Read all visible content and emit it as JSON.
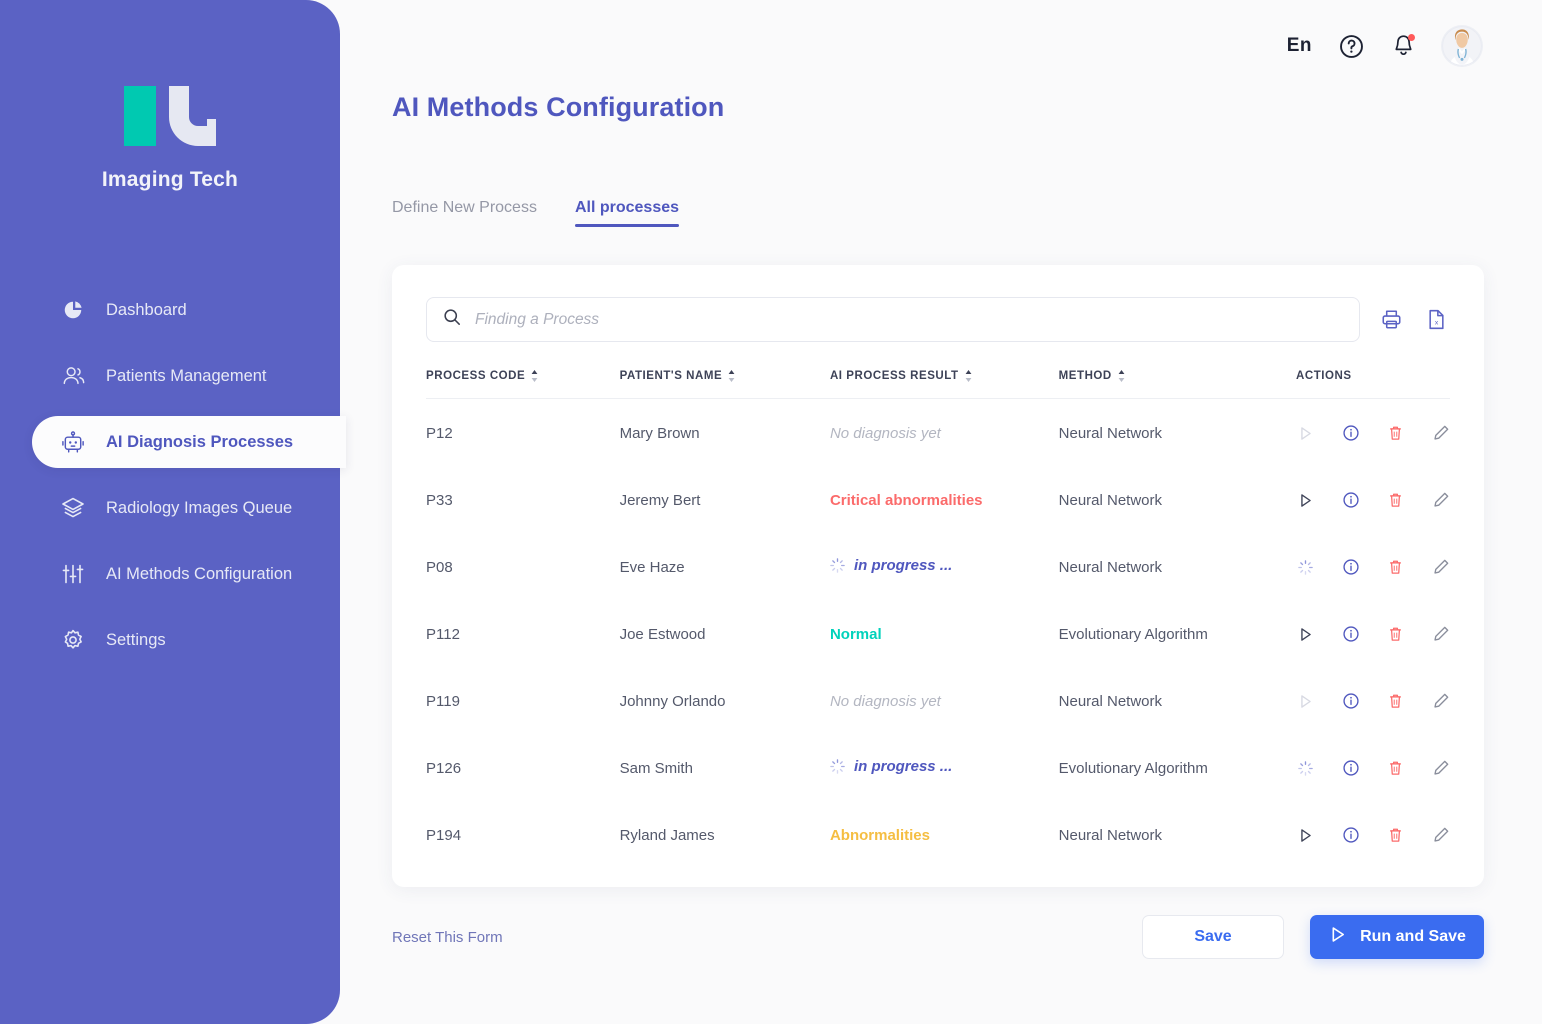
{
  "sidebar": {
    "brand": {
      "name": "Imaging Tech"
    },
    "items": [
      {
        "label": "Dashboard",
        "icon": "pie-chart-icon",
        "active": false
      },
      {
        "label": "Patients Management",
        "icon": "people-icon",
        "active": false
      },
      {
        "label": "AI Diagnosis Processes",
        "icon": "robot-icon",
        "active": true
      },
      {
        "label": "Radiology Images Queue",
        "icon": "layers-icon",
        "active": false
      },
      {
        "label": "AI Methods Configuration",
        "icon": "sliders-icon",
        "active": false
      },
      {
        "label": "Settings",
        "icon": "gear-icon",
        "active": false
      }
    ]
  },
  "topbar": {
    "language": "En",
    "help_icon": "help-circle-icon",
    "notifications_icon": "bell-icon",
    "has_notification": true,
    "avatar_icon": "doctor-avatar"
  },
  "page": {
    "title": "AI Methods Configuration"
  },
  "tabs": [
    {
      "label": "Define New Process",
      "active": false
    },
    {
      "label": "All processes",
      "active": true
    }
  ],
  "search": {
    "placeholder": "Finding a Process",
    "value": "",
    "icon": "search-icon"
  },
  "toolbar": {
    "print_icon": "printer-icon",
    "export_icon": "excel-file-icon",
    "export_badge": "x"
  },
  "table": {
    "columns": [
      {
        "label": "PROCESS CODE",
        "sortable": true
      },
      {
        "label": "PATIENT'S NAME",
        "sortable": true
      },
      {
        "label": "AI PROCESS RESULT",
        "sortable": true
      },
      {
        "label": "METHOD",
        "sortable": true
      },
      {
        "label": "ACTIONS",
        "sortable": false
      }
    ],
    "rows": [
      {
        "code": "P12",
        "name": "Mary Brown",
        "result": "No diagnosis yet",
        "result_state": "none",
        "method": "Neural Network",
        "run_enabled": false,
        "running": false
      },
      {
        "code": "P33",
        "name": "Jeremy Bert",
        "result": "Critical abnormalities",
        "result_state": "critical",
        "method": "Neural Network",
        "run_enabled": true,
        "running": false
      },
      {
        "code": "P08",
        "name": "Eve Haze",
        "result": "in progress ...",
        "result_state": "progress",
        "method": "Neural Network",
        "run_enabled": false,
        "running": true
      },
      {
        "code": "P112",
        "name": "Joe Estwood",
        "result": "Normal",
        "result_state": "normal",
        "method": "Evolutionary Algorithm",
        "run_enabled": true,
        "running": false
      },
      {
        "code": "P119",
        "name": "Johnny Orlando",
        "result": "No diagnosis yet",
        "result_state": "none",
        "method": "Neural Network",
        "run_enabled": false,
        "running": false
      },
      {
        "code": "P126",
        "name": "Sam Smith",
        "result": "in progress ...",
        "result_state": "progress",
        "method": "Evolutionary Algorithm",
        "run_enabled": false,
        "running": true
      },
      {
        "code": "P194",
        "name": "Ryland James",
        "result": "Abnormalities",
        "result_state": "abnormal",
        "method": "Neural Network",
        "run_enabled": true,
        "running": false
      }
    ],
    "action_icons": [
      "run-play-icon",
      "info-icon",
      "delete-icon",
      "edit-icon"
    ]
  },
  "footer": {
    "reset_label": "Reset This Form",
    "save_label": "Save",
    "run_save_label": "Run and Save",
    "run_icon": "play-icon"
  },
  "colors": {
    "sidebar": "#5B62C4",
    "brand_indigo": "#4F57BE",
    "primary_blue": "#3A6CF0",
    "teal": "#00D2BB",
    "amber": "#F5BE42",
    "red": "#FB6B6B",
    "logo_teal": "#00C9B1"
  }
}
